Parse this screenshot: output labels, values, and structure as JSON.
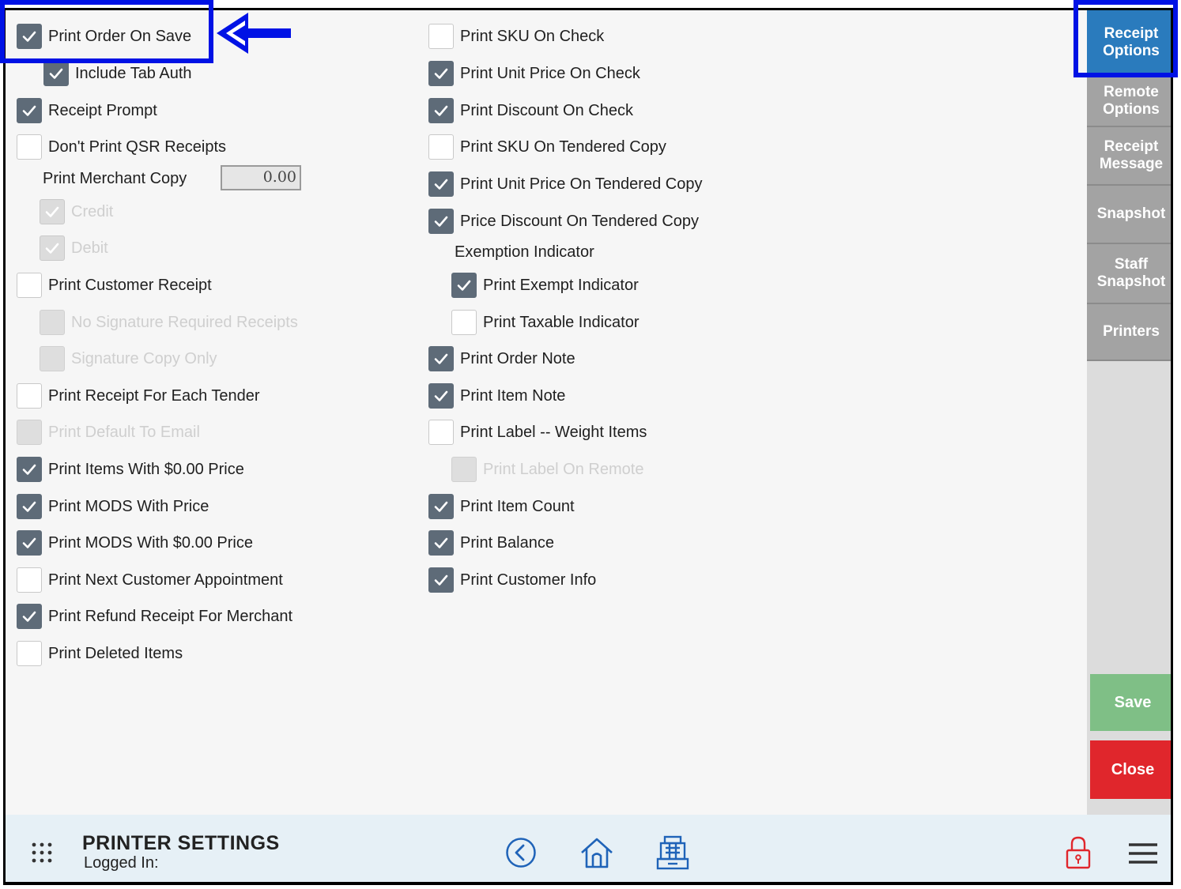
{
  "left_options": [
    {
      "label": "Print Order On Save",
      "checked": true,
      "disabled": false
    },
    {
      "label": "Include Tab Auth",
      "checked": true,
      "disabled": false
    },
    {
      "label": "Receipt Prompt",
      "checked": true,
      "disabled": false
    },
    {
      "label": "Don't Print QSR Receipts",
      "checked": false,
      "disabled": false
    },
    {
      "label": "Credit",
      "checked": true,
      "disabled": true
    },
    {
      "label": "Debit",
      "checked": true,
      "disabled": true
    },
    {
      "label": "Print Customer Receipt",
      "checked": false,
      "disabled": false
    },
    {
      "label": "No Signature Required Receipts",
      "checked": false,
      "disabled": true
    },
    {
      "label": "Signature Copy Only",
      "checked": false,
      "disabled": true
    },
    {
      "label": "Print Receipt For Each Tender",
      "checked": false,
      "disabled": false
    },
    {
      "label": "Print Default To Email",
      "checked": false,
      "disabled": true
    },
    {
      "label": "Print Items With $0.00 Price",
      "checked": true,
      "disabled": false
    },
    {
      "label": "Print MODS With Price",
      "checked": true,
      "disabled": false
    },
    {
      "label": "Print MODS With $0.00 Price",
      "checked": true,
      "disabled": false
    },
    {
      "label": "Print Next Customer Appointment",
      "checked": false,
      "disabled": false
    },
    {
      "label": "Print Refund Receipt For Merchant",
      "checked": true,
      "disabled": false
    },
    {
      "label": "Print Deleted Items",
      "checked": false,
      "disabled": false
    }
  ],
  "merchant_copy": {
    "label": "Print Merchant Copy",
    "value": "0.00"
  },
  "right_options": [
    {
      "label": "Print SKU On Check",
      "checked": false,
      "disabled": false
    },
    {
      "label": "Print Unit Price On Check",
      "checked": true,
      "disabled": false
    },
    {
      "label": "Print Discount On Check",
      "checked": true,
      "disabled": false
    },
    {
      "label": "Print SKU On Tendered Copy",
      "checked": false,
      "disabled": false
    },
    {
      "label": "Print Unit Price On Tendered Copy",
      "checked": true,
      "disabled": false
    },
    {
      "label": "Price Discount On Tendered Copy",
      "checked": true,
      "disabled": false
    },
    {
      "label": "Print Exempt Indicator",
      "checked": true,
      "disabled": false
    },
    {
      "label": "Print Taxable Indicator",
      "checked": false,
      "disabled": false
    },
    {
      "label": "Print Order Note",
      "checked": true,
      "disabled": false
    },
    {
      "label": "Print Item Note",
      "checked": true,
      "disabled": false
    },
    {
      "label": "Print Label -- Weight Items",
      "checked": false,
      "disabled": false
    },
    {
      "label": "Print Label On Remote",
      "checked": false,
      "disabled": true
    },
    {
      "label": "Print Item Count",
      "checked": true,
      "disabled": false
    },
    {
      "label": "Print Balance",
      "checked": true,
      "disabled": false
    },
    {
      "label": "Print Customer Info",
      "checked": true,
      "disabled": false
    }
  ],
  "exemption_label": "Exemption Indicator",
  "side_tabs": [
    {
      "label": "Receipt Options",
      "active": true
    },
    {
      "label": "Remote Options",
      "active": false
    },
    {
      "label": "Receipt Message",
      "active": false
    },
    {
      "label": "Snapshot",
      "active": false
    },
    {
      "label": "Staff Snapshot",
      "active": false
    },
    {
      "label": "Printers",
      "active": false
    }
  ],
  "actions": {
    "save": "Save",
    "close": "Close"
  },
  "footer": {
    "title": "PRINTER SETTINGS",
    "subtitle": "Logged In:"
  },
  "icons": [
    "apps-grid-icon",
    "back-circle-icon",
    "home-icon",
    "cash-register-icon",
    "lock-icon",
    "hamburger-menu-icon",
    "arrow-left-icon"
  ],
  "colors": {
    "active_tab": "#2a7bbd",
    "save": "#7fbf86",
    "close": "#e0262c",
    "highlight": "#0012e5",
    "checkbox_on": "#5e6b78"
  }
}
